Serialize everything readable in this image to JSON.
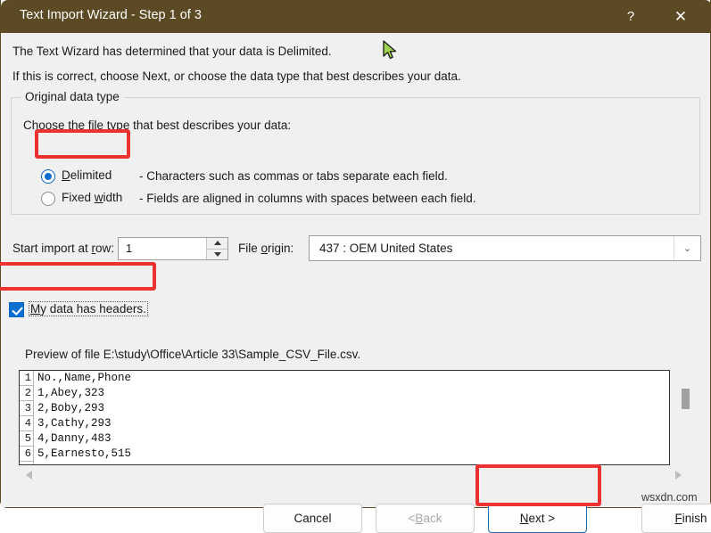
{
  "window": {
    "title": "Text Import Wizard - Step 1 of 3",
    "help_icon": "?",
    "close_icon": "✕"
  },
  "intro": {
    "line1": "The Text Wizard has determined that your data is Delimited.",
    "line2": "If this is correct, choose Next, or choose the data type that best describes your data."
  },
  "original_data_type": {
    "legend": "Original data type",
    "choose_label": "Choose the file type that best describes your data:",
    "options": [
      {
        "label_pre": "",
        "label_accel": "D",
        "label_post": "elimited",
        "description": "- Characters such as commas or tabs separate each field.",
        "selected": true
      },
      {
        "label_pre": "Fixed ",
        "label_accel": "w",
        "label_post": "idth",
        "description": "- Fields are aligned in columns with spaces between each field.",
        "selected": false
      }
    ]
  },
  "start_import": {
    "label_pre": "Start import at ",
    "label_accel": "r",
    "label_post": "ow:",
    "value": "1",
    "spin_up_icon": "spinner-up-icon",
    "spin_down_icon": "spinner-down-icon"
  },
  "file_origin": {
    "label_pre": "File ",
    "label_accel": "o",
    "label_post": "rigin:",
    "selected": "437 : OEM United States",
    "arrow_icon": "⌄"
  },
  "headers_checkbox": {
    "checked": true,
    "label_pre": "",
    "label_accel": "M",
    "label_post": "y data has headers."
  },
  "preview": {
    "label": "Preview of file E:\\study\\Office\\Article 33\\Sample_CSV_File.csv.",
    "rows": [
      {
        "n": "1",
        "text": "No.,Name,Phone"
      },
      {
        "n": "2",
        "text": "1,Abey,323"
      },
      {
        "n": "3",
        "text": "2,Boby,293"
      },
      {
        "n": "4",
        "text": "3,Cathy,293"
      },
      {
        "n": "5",
        "text": "4,Danny,483"
      },
      {
        "n": "6",
        "text": "5,Earnesto,515"
      }
    ]
  },
  "buttons": {
    "cancel": {
      "label": "Cancel",
      "enabled": true
    },
    "back": {
      "label_pre": "< ",
      "label_accel": "B",
      "label_post": "ack",
      "enabled": false
    },
    "next": {
      "label_pre": "",
      "label_accel": "N",
      "label_post": "ext >",
      "enabled": true,
      "focused": true
    },
    "finish": {
      "label_pre": "",
      "label_accel": "F",
      "label_post": "inish",
      "enabled": true
    }
  },
  "annotations": {
    "color": "#ee3131",
    "targets": [
      "delimited-radio",
      "my-data-has-headers-checkbox",
      "next-button"
    ]
  },
  "watermark": "wsxdn.com",
  "colors": {
    "titlebar": "#5b4a24",
    "dialog_bg": "#f0f0f0",
    "accent_blue": "#0a6fd0",
    "annotation_red": "#ee3131"
  }
}
